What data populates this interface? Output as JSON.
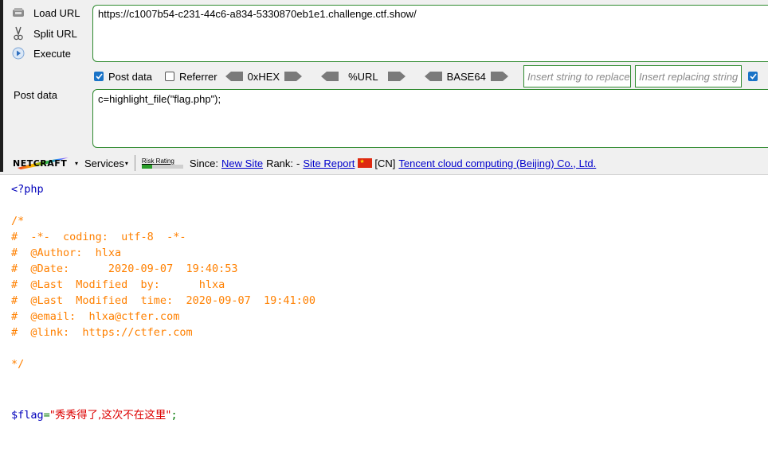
{
  "hackbar": {
    "load_url": "Load URL",
    "split_url": "Split URL",
    "execute": "Execute",
    "url_value": "https://c1007b54-c231-44c6-a834-5330870eb1e1.challenge.ctf.show/",
    "post_data_checkbox": "Post data",
    "referrer_checkbox": "Referrer",
    "hex_label": "0xHEX",
    "url_label": "%URL",
    "base64_label": "BASE64",
    "replace_find_placeholder": "Insert string to replace",
    "replace_with_placeholder": "Insert replacing string",
    "post_data_label": "Post data",
    "post_data_value": "c=highlight_file(\"flag.php\");",
    "accent": "#1a73c7",
    "border": "#2f8a2f"
  },
  "netcraft": {
    "logo": "NETCRAFT",
    "services": "Services",
    "risk_rating": "Risk Rating",
    "since_label": "Since:",
    "since_value": "New Site",
    "rank_label": "Rank:",
    "rank_value": "-",
    "site_report": "Site Report",
    "country": "[CN]",
    "host": "Tencent cloud computing (Beijing) Co., Ltd."
  },
  "code": {
    "open_tag": "<?php",
    "comment_open": "/*",
    "lines": [
      "#  -*-  coding:  utf-8  -*-",
      "#  @Author:  hlxa",
      "#  @Date:      2020-09-07  19:40:53",
      "#  @Last  Modified  by:      hlxa",
      "#  @Last  Modified  time:  2020-09-07  19:41:00",
      "#  @email:  hlxa@ctfer.com",
      "#  @link:  https://ctfer.com"
    ],
    "comment_close": "*/",
    "flag_var": "$flag",
    "flag_eq": "=",
    "flag_string": "\"秀秀得了,这次不在这里\"",
    "flag_semi": ";",
    "colors": {
      "keyword": "#0000bb",
      "comment": "#ff8000",
      "string": "#dd0000",
      "plain": "#007700"
    }
  }
}
